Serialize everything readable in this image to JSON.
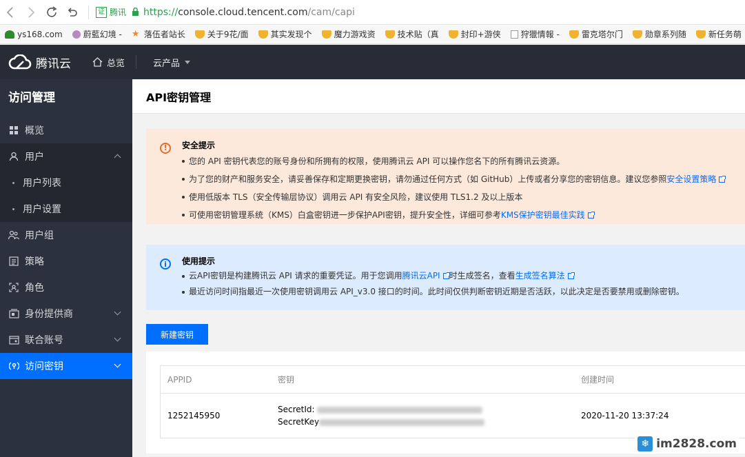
{
  "browser": {
    "cert_badge": "证",
    "cert_name": "腾讯",
    "url_proto": "https://",
    "url_host": "console.cloud.tencent.com",
    "url_path": "/cam/capi",
    "bookmarks": [
      {
        "label": "ys168.com",
        "icon": "tree"
      },
      {
        "label": "蔚藍幻境 -",
        "icon": "person"
      },
      {
        "label": "落伍者站长",
        "icon": "star"
      },
      {
        "label": "关于9花/面",
        "icon": "trophy"
      },
      {
        "label": "其实发现个",
        "icon": "trophy"
      },
      {
        "label": "魔力游戏资",
        "icon": "trophy"
      },
      {
        "label": "技术贴（真",
        "icon": "trophy"
      },
      {
        "label": "封印+游侠",
        "icon": "trophy"
      },
      {
        "label": "狩獵情報 -",
        "icon": "doc"
      },
      {
        "label": "雷克塔尔门",
        "icon": "trophy"
      },
      {
        "label": "勋章系列随",
        "icon": "trophy"
      },
      {
        "label": "新任务萌",
        "icon": "trophy"
      }
    ]
  },
  "topnav": {
    "logo": "腾讯云",
    "home": "总览",
    "products": "云产品"
  },
  "sidebar": {
    "title": "访问管理",
    "overview": "概览",
    "users": "用户",
    "user_list": "用户列表",
    "user_settings": "用户设置",
    "groups": "用户组",
    "policies": "策略",
    "roles": "角色",
    "idp": "身份提供商",
    "federated": "联合账号",
    "api_keys": "访问密钥"
  },
  "page": {
    "title": "API密钥管理"
  },
  "security_tip": {
    "title": "安全提示",
    "line1": "您的 API 密钥代表您的账号身份和所拥有的权限，使用腾讯云 API 可以操作您名下的所有腾讯云资源。",
    "line2_pre": "为了您的财产和服务安全，请妥善保存和定期更换密钥，请勿通过任何方式（如 GitHub）上传或者分享您的密钥信息。建议您参照",
    "line2_link": "安全设置策略",
    "line3": "使用低版本 TLS（安全传输层协议）调用云 API 有安全风险，建议使用 TLS1.2 及以上版本",
    "line4_pre": "可使用密钥管理系统（KMS）白盒密钥进一步保护API密钥，提升安全性，详细可参考",
    "line4_link": "KMS保护密钥最佳实践"
  },
  "usage_tip": {
    "title": "使用提示",
    "line1_pre": "云API密钥是构建腾讯云 API 请求的重要凭证。用于您调用",
    "line1_link1": "腾讯云API",
    "line1_mid": "时生成签名，查看",
    "line1_link2": "生成签名算法",
    "line2": "最近访问时间指最近一次使用密钥调用云 API_v3.0 接口的时间。此时间仅供判断密钥近期是否活跃，以此决定是否要禁用或删除密钥。"
  },
  "new_key_button": "新建密钥",
  "table": {
    "headers": [
      "APPID",
      "密钥",
      "创建时间"
    ],
    "rows": [
      {
        "appid": "1252145950",
        "secret_id_label": "SecretId: ",
        "secret_key_label": "SecretKey",
        "created": "2020-11-20 13:37:24"
      }
    ]
  },
  "watermark": "im2828.com"
}
